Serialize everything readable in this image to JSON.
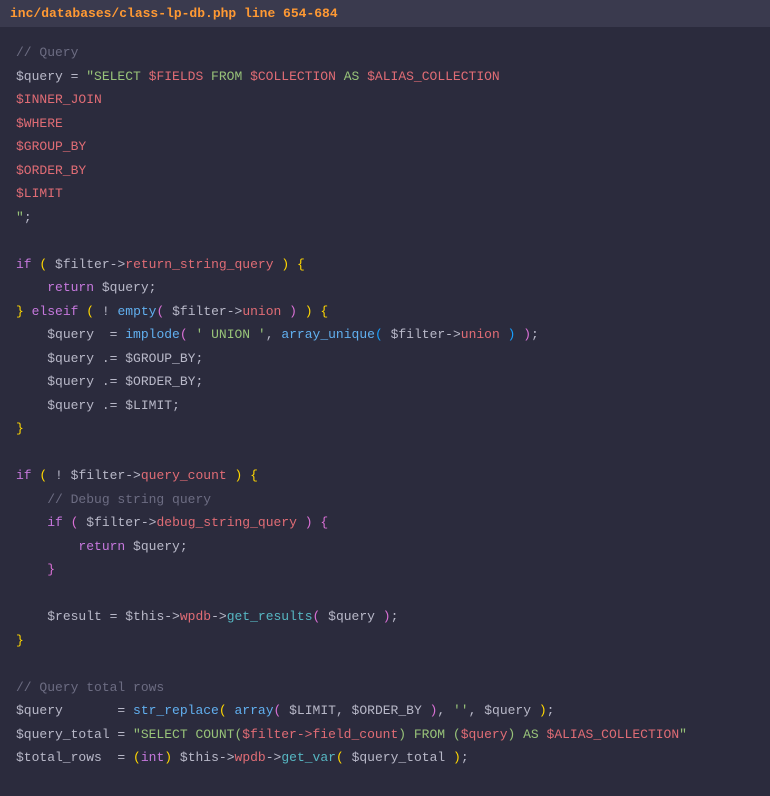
{
  "header": {
    "path": "inc/databases/class-lp-db.php line 654-684"
  },
  "code": {
    "tokens": [
      [
        {
          "t": "// Query",
          "c": "comment"
        }
      ],
      [
        {
          "t": "$query",
          "c": "variable"
        },
        {
          "t": " = ",
          "c": "operator"
        },
        {
          "t": "\"SELECT ",
          "c": "string"
        },
        {
          "t": "$FIELDS",
          "c": "interp"
        },
        {
          "t": " FROM ",
          "c": "string"
        },
        {
          "t": "$COLLECTION",
          "c": "interp"
        },
        {
          "t": " AS ",
          "c": "string"
        },
        {
          "t": "$ALIAS_COLLECTION",
          "c": "interp"
        }
      ],
      [
        {
          "t": "$INNER_JOIN",
          "c": "interp"
        }
      ],
      [
        {
          "t": "$WHERE",
          "c": "interp"
        }
      ],
      [
        {
          "t": "$GROUP_BY",
          "c": "interp"
        }
      ],
      [
        {
          "t": "$ORDER_BY",
          "c": "interp"
        }
      ],
      [
        {
          "t": "$LIMIT",
          "c": "interp"
        }
      ],
      [
        {
          "t": "\"",
          "c": "string"
        },
        {
          "t": ";",
          "c": "punct"
        }
      ],
      [],
      [
        {
          "t": "if",
          "c": "keyword"
        },
        {
          "t": " ",
          "c": "punct"
        },
        {
          "t": "(",
          "c": "brace"
        },
        {
          "t": " ",
          "c": "punct"
        },
        {
          "t": "$filter",
          "c": "variable"
        },
        {
          "t": "->",
          "c": "arrow"
        },
        {
          "t": "return_string_query",
          "c": "property"
        },
        {
          "t": " ",
          "c": "punct"
        },
        {
          "t": ")",
          "c": "brace"
        },
        {
          "t": " ",
          "c": "punct"
        },
        {
          "t": "{",
          "c": "brace"
        }
      ],
      [
        {
          "t": "    ",
          "c": "punct"
        },
        {
          "t": "return",
          "c": "keyword"
        },
        {
          "t": " ",
          "c": "punct"
        },
        {
          "t": "$query",
          "c": "variable"
        },
        {
          "t": ";",
          "c": "punct"
        }
      ],
      [
        {
          "t": "}",
          "c": "brace"
        },
        {
          "t": " ",
          "c": "punct"
        },
        {
          "t": "elseif",
          "c": "keyword"
        },
        {
          "t": " ",
          "c": "punct"
        },
        {
          "t": "(",
          "c": "brace"
        },
        {
          "t": " ! ",
          "c": "operator"
        },
        {
          "t": "empty",
          "c": "function"
        },
        {
          "t": "(",
          "c": "brace2"
        },
        {
          "t": " ",
          "c": "punct"
        },
        {
          "t": "$filter",
          "c": "variable"
        },
        {
          "t": "->",
          "c": "arrow"
        },
        {
          "t": "union",
          "c": "property"
        },
        {
          "t": " ",
          "c": "punct"
        },
        {
          "t": ")",
          "c": "brace2"
        },
        {
          "t": " ",
          "c": "punct"
        },
        {
          "t": ")",
          "c": "brace"
        },
        {
          "t": " ",
          "c": "punct"
        },
        {
          "t": "{",
          "c": "brace"
        }
      ],
      [
        {
          "t": "    ",
          "c": "punct"
        },
        {
          "t": "$query",
          "c": "variable"
        },
        {
          "t": "  = ",
          "c": "operator"
        },
        {
          "t": "implode",
          "c": "function"
        },
        {
          "t": "(",
          "c": "brace2"
        },
        {
          "t": " ",
          "c": "punct"
        },
        {
          "t": "' UNION '",
          "c": "string"
        },
        {
          "t": ", ",
          "c": "punct"
        },
        {
          "t": "array_unique",
          "c": "function"
        },
        {
          "t": "(",
          "c": "brace3"
        },
        {
          "t": " ",
          "c": "punct"
        },
        {
          "t": "$filter",
          "c": "variable"
        },
        {
          "t": "->",
          "c": "arrow"
        },
        {
          "t": "union",
          "c": "property"
        },
        {
          "t": " ",
          "c": "punct"
        },
        {
          "t": ")",
          "c": "brace3"
        },
        {
          "t": " ",
          "c": "punct"
        },
        {
          "t": ")",
          "c": "brace2"
        },
        {
          "t": ";",
          "c": "punct"
        }
      ],
      [
        {
          "t": "    ",
          "c": "punct"
        },
        {
          "t": "$query",
          "c": "variable"
        },
        {
          "t": " .= ",
          "c": "operator"
        },
        {
          "t": "$GROUP_BY",
          "c": "variable"
        },
        {
          "t": ";",
          "c": "punct"
        }
      ],
      [
        {
          "t": "    ",
          "c": "punct"
        },
        {
          "t": "$query",
          "c": "variable"
        },
        {
          "t": " .= ",
          "c": "operator"
        },
        {
          "t": "$ORDER_BY",
          "c": "variable"
        },
        {
          "t": ";",
          "c": "punct"
        }
      ],
      [
        {
          "t": "    ",
          "c": "punct"
        },
        {
          "t": "$query",
          "c": "variable"
        },
        {
          "t": " .= ",
          "c": "operator"
        },
        {
          "t": "$LIMIT",
          "c": "variable"
        },
        {
          "t": ";",
          "c": "punct"
        }
      ],
      [
        {
          "t": "}",
          "c": "brace"
        }
      ],
      [],
      [
        {
          "t": "if",
          "c": "keyword"
        },
        {
          "t": " ",
          "c": "punct"
        },
        {
          "t": "(",
          "c": "brace"
        },
        {
          "t": " ! ",
          "c": "operator"
        },
        {
          "t": "$filter",
          "c": "variable"
        },
        {
          "t": "->",
          "c": "arrow"
        },
        {
          "t": "query_count",
          "c": "property"
        },
        {
          "t": " ",
          "c": "punct"
        },
        {
          "t": ")",
          "c": "brace"
        },
        {
          "t": " ",
          "c": "punct"
        },
        {
          "t": "{",
          "c": "brace"
        }
      ],
      [
        {
          "t": "    ",
          "c": "punct"
        },
        {
          "t": "// Debug string query",
          "c": "comment"
        }
      ],
      [
        {
          "t": "    ",
          "c": "punct"
        },
        {
          "t": "if",
          "c": "keyword"
        },
        {
          "t": " ",
          "c": "punct"
        },
        {
          "t": "(",
          "c": "brace2"
        },
        {
          "t": " ",
          "c": "punct"
        },
        {
          "t": "$filter",
          "c": "variable"
        },
        {
          "t": "->",
          "c": "arrow"
        },
        {
          "t": "debug_string_query",
          "c": "property"
        },
        {
          "t": " ",
          "c": "punct"
        },
        {
          "t": ")",
          "c": "brace2"
        },
        {
          "t": " ",
          "c": "punct"
        },
        {
          "t": "{",
          "c": "brace2"
        }
      ],
      [
        {
          "t": "        ",
          "c": "punct"
        },
        {
          "t": "return",
          "c": "keyword"
        },
        {
          "t": " ",
          "c": "punct"
        },
        {
          "t": "$query",
          "c": "variable"
        },
        {
          "t": ";",
          "c": "punct"
        }
      ],
      [
        {
          "t": "    ",
          "c": "punct"
        },
        {
          "t": "}",
          "c": "brace2"
        }
      ],
      [],
      [
        {
          "t": "    ",
          "c": "punct"
        },
        {
          "t": "$result",
          "c": "variable"
        },
        {
          "t": " = ",
          "c": "operator"
        },
        {
          "t": "$this",
          "c": "variable"
        },
        {
          "t": "->",
          "c": "arrow"
        },
        {
          "t": "wpdb",
          "c": "property"
        },
        {
          "t": "->",
          "c": "arrow"
        },
        {
          "t": "get_results",
          "c": "method"
        },
        {
          "t": "(",
          "c": "brace2"
        },
        {
          "t": " ",
          "c": "punct"
        },
        {
          "t": "$query",
          "c": "variable"
        },
        {
          "t": " ",
          "c": "punct"
        },
        {
          "t": ")",
          "c": "brace2"
        },
        {
          "t": ";",
          "c": "punct"
        }
      ],
      [
        {
          "t": "}",
          "c": "brace"
        }
      ],
      [],
      [
        {
          "t": "// Query total rows",
          "c": "comment"
        }
      ],
      [
        {
          "t": "$query",
          "c": "variable"
        },
        {
          "t": "       = ",
          "c": "operator"
        },
        {
          "t": "str_replace",
          "c": "function"
        },
        {
          "t": "(",
          "c": "brace"
        },
        {
          "t": " ",
          "c": "punct"
        },
        {
          "t": "array",
          "c": "function"
        },
        {
          "t": "(",
          "c": "brace2"
        },
        {
          "t": " ",
          "c": "punct"
        },
        {
          "t": "$LIMIT",
          "c": "variable"
        },
        {
          "t": ", ",
          "c": "punct"
        },
        {
          "t": "$ORDER_BY",
          "c": "variable"
        },
        {
          "t": " ",
          "c": "punct"
        },
        {
          "t": ")",
          "c": "brace2"
        },
        {
          "t": ", ",
          "c": "punct"
        },
        {
          "t": "''",
          "c": "string"
        },
        {
          "t": ", ",
          "c": "punct"
        },
        {
          "t": "$query",
          "c": "variable"
        },
        {
          "t": " ",
          "c": "punct"
        },
        {
          "t": ")",
          "c": "brace"
        },
        {
          "t": ";",
          "c": "punct"
        }
      ],
      [
        {
          "t": "$query_total",
          "c": "variable"
        },
        {
          "t": " = ",
          "c": "operator"
        },
        {
          "t": "\"SELECT COUNT(",
          "c": "string"
        },
        {
          "t": "$filter->field_count",
          "c": "interp"
        },
        {
          "t": ") FROM (",
          "c": "string"
        },
        {
          "t": "$query",
          "c": "interp"
        },
        {
          "t": ") AS ",
          "c": "string"
        },
        {
          "t": "$ALIAS_COLLECTION",
          "c": "interp"
        },
        {
          "t": "\"",
          "c": "string"
        }
      ],
      [
        {
          "t": "$total_rows",
          "c": "variable"
        },
        {
          "t": "  = ",
          "c": "operator"
        },
        {
          "t": "(",
          "c": "brace"
        },
        {
          "t": "int",
          "c": "keyword"
        },
        {
          "t": ")",
          "c": "brace"
        },
        {
          "t": " ",
          "c": "punct"
        },
        {
          "t": "$this",
          "c": "variable"
        },
        {
          "t": "->",
          "c": "arrow"
        },
        {
          "t": "wpdb",
          "c": "property"
        },
        {
          "t": "->",
          "c": "arrow"
        },
        {
          "t": "get_var",
          "c": "method"
        },
        {
          "t": "(",
          "c": "brace"
        },
        {
          "t": " ",
          "c": "punct"
        },
        {
          "t": "$query_total",
          "c": "variable"
        },
        {
          "t": " ",
          "c": "punct"
        },
        {
          "t": ")",
          "c": "brace"
        },
        {
          "t": ";",
          "c": "punct"
        }
      ]
    ]
  }
}
